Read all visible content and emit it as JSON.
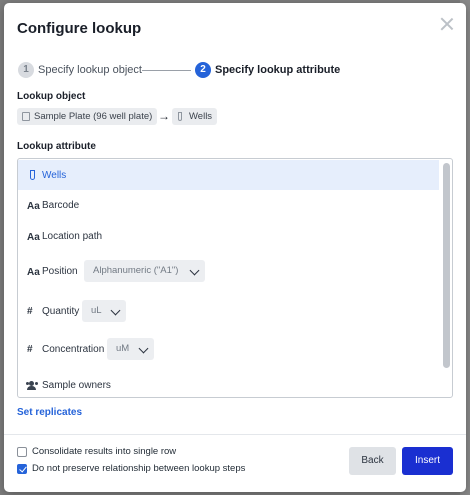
{
  "dialog": {
    "title": "Configure lookup",
    "close_icon": "close-icon"
  },
  "stepper": {
    "steps": [
      {
        "number": "1",
        "label": "Specify lookup object",
        "state": "done"
      },
      {
        "number": "2",
        "label": "Specify lookup attribute",
        "state": "active"
      }
    ]
  },
  "lookup_object": {
    "label": "Lookup object",
    "chips": [
      {
        "label": "Sample Plate (96 well plate)",
        "icon": "plate-icon"
      },
      {
        "label": "Wells",
        "icon": "tube-icon"
      }
    ],
    "arrow": "→"
  },
  "lookup_attribute": {
    "label": "Lookup attribute",
    "items": [
      {
        "icon": "tube-icon",
        "label": "Wells",
        "selected": true
      },
      {
        "icon": "text-type-icon",
        "icon_text": "Aa",
        "label": "Barcode"
      },
      {
        "icon": "text-type-icon",
        "icon_text": "Aa",
        "label": "Location path"
      },
      {
        "icon": "text-type-icon",
        "icon_text": "Aa",
        "label": "Position",
        "select_value": "Alphanumeric (\"A1\")"
      },
      {
        "icon": "number-type-icon",
        "icon_text": "#",
        "label": "Quantity",
        "select_value": "uL"
      },
      {
        "icon": "number-type-icon",
        "icon_text": "#",
        "label": "Concentration",
        "select_value": "uM"
      },
      {
        "icon": "people-icon",
        "label": "Sample owners"
      }
    ]
  },
  "set_replicates_label": "Set replicates",
  "options": [
    {
      "label": "Consolidate results into single row",
      "checked": false
    },
    {
      "label": "Do not preserve relationship between lookup steps",
      "checked": true
    }
  ],
  "buttons": {
    "back_label": "Back",
    "insert_label": "Insert"
  },
  "colors": {
    "accent": "#2563d9",
    "insert_button": "#1a2fd1"
  }
}
